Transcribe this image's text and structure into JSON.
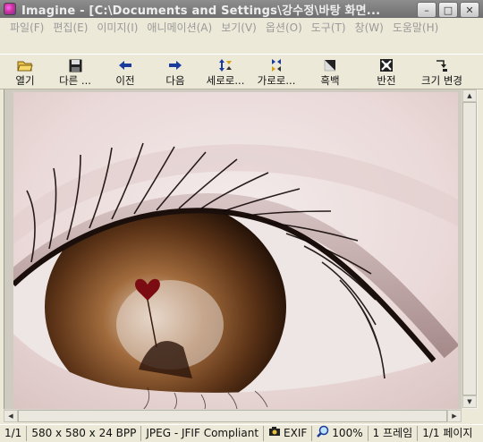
{
  "window": {
    "title": "Imagine - [C:\\Documents and Settings\\강수정\\바탕 화면...",
    "controls": [
      {
        "name": "minimize",
        "glyph": "–"
      },
      {
        "name": "maximize",
        "glyph": "□"
      },
      {
        "name": "close",
        "glyph": "✕"
      }
    ]
  },
  "menu": {
    "items": [
      "파일(F)",
      "편집(E)",
      "이미지(I)",
      "애니메이션(A)",
      "보기(V)",
      "옵션(O)",
      "도구(T)",
      "창(W)",
      "도움말(H)"
    ]
  },
  "toolbar": {
    "buttons": [
      {
        "label": "열기",
        "icon": "open-folder-icon"
      },
      {
        "label": "다른 ...",
        "icon": "save-disk-icon"
      },
      {
        "label": "이전",
        "icon": "arrow-left-icon"
      },
      {
        "label": "다음",
        "icon": "arrow-right-icon"
      },
      {
        "label": "세로로...",
        "icon": "flip-vertical-icon"
      },
      {
        "label": "가로로...",
        "icon": "flip-horizontal-icon"
      },
      {
        "label": "흑백",
        "icon": "grayscale-icon"
      },
      {
        "label": "반전",
        "icon": "invert-icon"
      },
      {
        "label": "크기 변경",
        "icon": "resize-icon"
      }
    ]
  },
  "status": {
    "page": "1/1",
    "dimensions": "580 x 580 x 24 BPP",
    "format": "JPEG - JFIF Compliant",
    "exif": "EXIF",
    "zoom": "100%",
    "frames": "1 프레임",
    "pages": "1/1 페이지"
  },
  "colors": {
    "titlebar": "#7a7a7a",
    "face": "#ece9d8",
    "arrow_blue": "#1a3b9c"
  }
}
